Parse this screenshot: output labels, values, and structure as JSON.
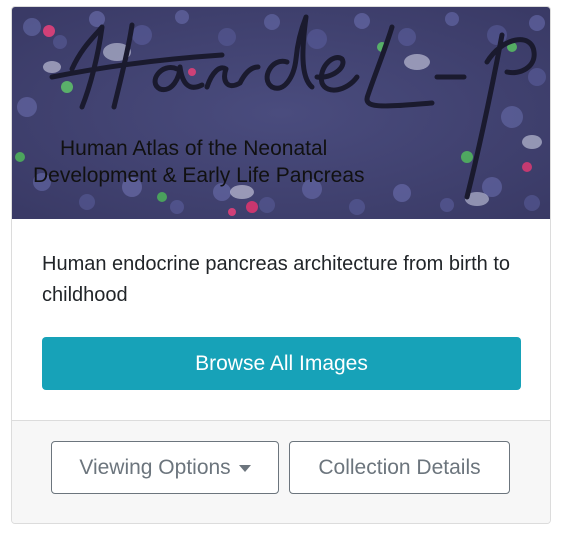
{
  "banner": {
    "logo_text": "Handel-P",
    "subtitle_line1": "Human Atlas of the Neonatal",
    "subtitle_line2": "Development & Early Life Pancreas"
  },
  "card": {
    "description": "Human endocrine pancreas architecture from birth to childhood",
    "browse_label": "Browse All Images"
  },
  "footer": {
    "viewing_options_label": "Viewing Options",
    "collection_details_label": "Collection Details"
  },
  "colors": {
    "primary": "#17a2b8",
    "secondary": "#6c757d",
    "footer_bg": "#f7f7f7"
  }
}
